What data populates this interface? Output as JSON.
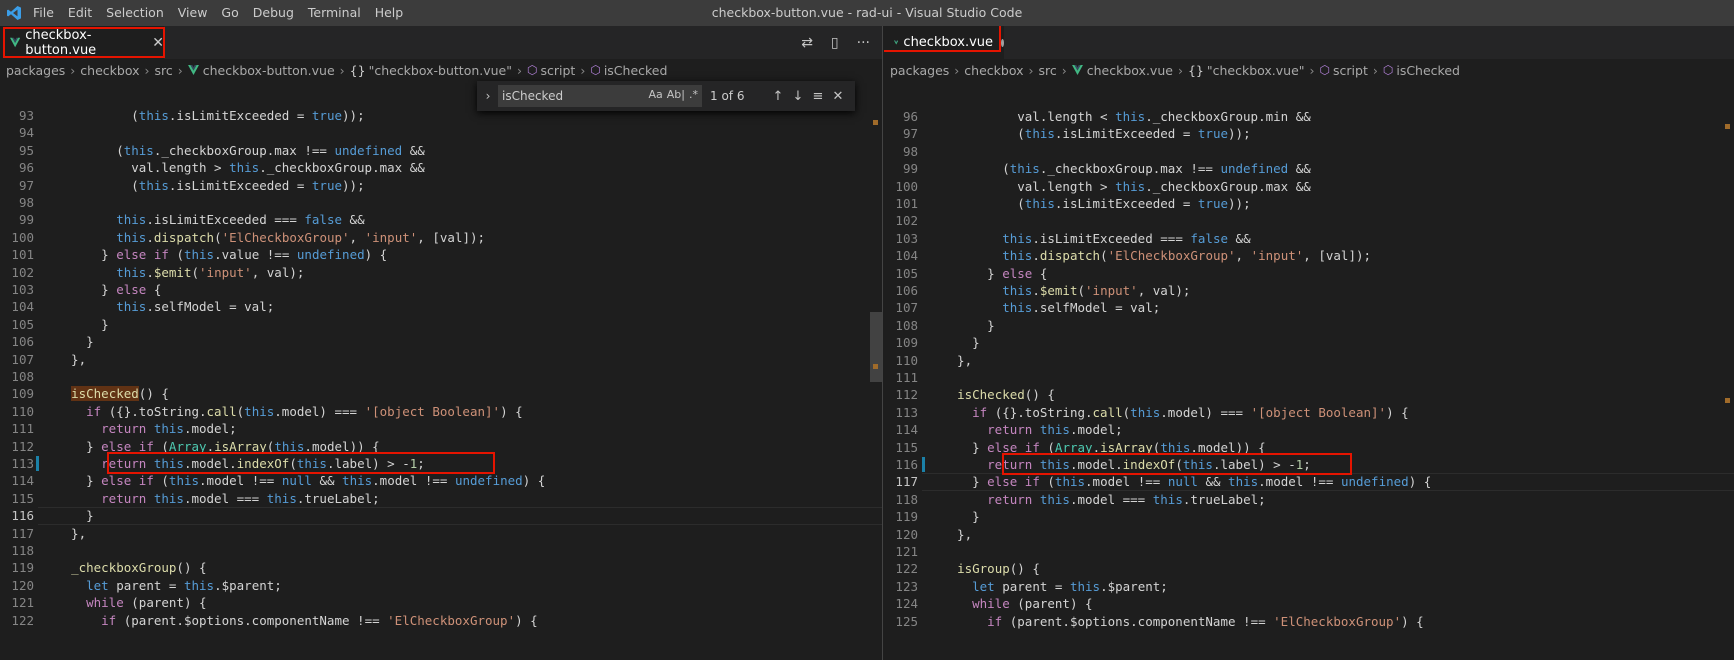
{
  "titlebar": {
    "menu": [
      "File",
      "Edit",
      "Selection",
      "View",
      "Go",
      "Debug",
      "Terminal",
      "Help"
    ],
    "window_title": "checkbox-button.vue - rad-ui - Visual Studio Code"
  },
  "left": {
    "tab_label": "checkbox-button.vue",
    "breadcrumb": [
      "packages",
      "checkbox",
      "src",
      "checkbox-button.vue",
      "\"checkbox-button.vue\"",
      "script",
      "isChecked"
    ],
    "find": {
      "query": "isChecked",
      "count": "1 of 6",
      "opt_case": "Aa",
      "opt_word": "Ab|",
      "opt_regex": ".*"
    },
    "lines": [
      {
        "n": "93",
        "t": "          (this.isLimitExceeded = true));"
      },
      {
        "n": "94",
        "t": ""
      },
      {
        "n": "95",
        "t": "        (this._checkboxGroup.max !== undefined &&"
      },
      {
        "n": "96",
        "t": "          val.length > this._checkboxGroup.max &&"
      },
      {
        "n": "97",
        "t": "          (this.isLimitExceeded = true));"
      },
      {
        "n": "98",
        "t": ""
      },
      {
        "n": "99",
        "t": "        this.isLimitExceeded === false &&"
      },
      {
        "n": "100",
        "t": "        this.dispatch('ElCheckboxGroup', 'input', [val]);"
      },
      {
        "n": "101",
        "t": "      } else if (this.value !== undefined) {"
      },
      {
        "n": "102",
        "t": "        this.$emit('input', val);"
      },
      {
        "n": "103",
        "t": "      } else {"
      },
      {
        "n": "104",
        "t": "        this.selfModel = val;"
      },
      {
        "n": "105",
        "t": "      }"
      },
      {
        "n": "106",
        "t": "    }"
      },
      {
        "n": "107",
        "t": "  },"
      },
      {
        "n": "108",
        "t": ""
      },
      {
        "n": "109",
        "t": "  isChecked() {"
      },
      {
        "n": "110",
        "t": "    if ({}.toString.call(this.model) === '[object Boolean]') {"
      },
      {
        "n": "111",
        "t": "      return this.model;"
      },
      {
        "n": "112",
        "t": "    } else if (Array.isArray(this.model)) {"
      },
      {
        "n": "113",
        "t": "      return this.model.indexOf(this.label) > -1;"
      },
      {
        "n": "114",
        "t": "    } else if (this.model !== null && this.model !== undefined) {"
      },
      {
        "n": "115",
        "t": "      return this.model === this.trueLabel;"
      },
      {
        "n": "116",
        "t": "    }"
      },
      {
        "n": "117",
        "t": "  },"
      },
      {
        "n": "118",
        "t": ""
      },
      {
        "n": "119",
        "t": "  _checkboxGroup() {"
      },
      {
        "n": "120",
        "t": "    let parent = this.$parent;"
      },
      {
        "n": "121",
        "t": "    while (parent) {"
      },
      {
        "n": "122",
        "t": "      if (parent.$options.componentName !== 'ElCheckboxGroup') {"
      }
    ]
  },
  "right": {
    "tab_label": "checkbox.vue",
    "breadcrumb": [
      "packages",
      "checkbox",
      "src",
      "checkbox.vue",
      "\"checkbox.vue\"",
      "script",
      "isChecked"
    ],
    "lines": [
      {
        "n": "96",
        "t": "          val.length < this._checkboxGroup.min &&"
      },
      {
        "n": "97",
        "t": "          (this.isLimitExceeded = true));"
      },
      {
        "n": "98",
        "t": ""
      },
      {
        "n": "99",
        "t": "        (this._checkboxGroup.max !== undefined &&"
      },
      {
        "n": "100",
        "t": "          val.length > this._checkboxGroup.max &&"
      },
      {
        "n": "101",
        "t": "          (this.isLimitExceeded = true));"
      },
      {
        "n": "102",
        "t": ""
      },
      {
        "n": "103",
        "t": "        this.isLimitExceeded === false &&"
      },
      {
        "n": "104",
        "t": "        this.dispatch('ElCheckboxGroup', 'input', [val]);"
      },
      {
        "n": "105",
        "t": "      } else {"
      },
      {
        "n": "106",
        "t": "        this.$emit('input', val);"
      },
      {
        "n": "107",
        "t": "        this.selfModel = val;"
      },
      {
        "n": "108",
        "t": "      }"
      },
      {
        "n": "109",
        "t": "    }"
      },
      {
        "n": "110",
        "t": "  },"
      },
      {
        "n": "111",
        "t": ""
      },
      {
        "n": "112",
        "t": "  isChecked() {"
      },
      {
        "n": "113",
        "t": "    if ({}.toString.call(this.model) === '[object Boolean]') {"
      },
      {
        "n": "114",
        "t": "      return this.model;"
      },
      {
        "n": "115",
        "t": "    } else if (Array.isArray(this.model)) {"
      },
      {
        "n": "116",
        "t": "      return this.model.indexOf(this.label) > -1;"
      },
      {
        "n": "117",
        "t": "    } else if (this.model !== null && this.model !== undefined) {"
      },
      {
        "n": "118",
        "t": "      return this.model === this.trueLabel;"
      },
      {
        "n": "119",
        "t": "    }"
      },
      {
        "n": "120",
        "t": "  },"
      },
      {
        "n": "121",
        "t": ""
      },
      {
        "n": "122",
        "t": "  isGroup() {"
      },
      {
        "n": "123",
        "t": "    let parent = this.$parent;"
      },
      {
        "n": "124",
        "t": "    while (parent) {"
      },
      {
        "n": "125",
        "t": "      if (parent.$options.componentName !== 'ElCheckboxGroup') {"
      }
    ]
  },
  "colors": {
    "keyword": "#569cd6",
    "control": "#c586c0",
    "string": "#ce9178",
    "annotation": "#e51400"
  }
}
